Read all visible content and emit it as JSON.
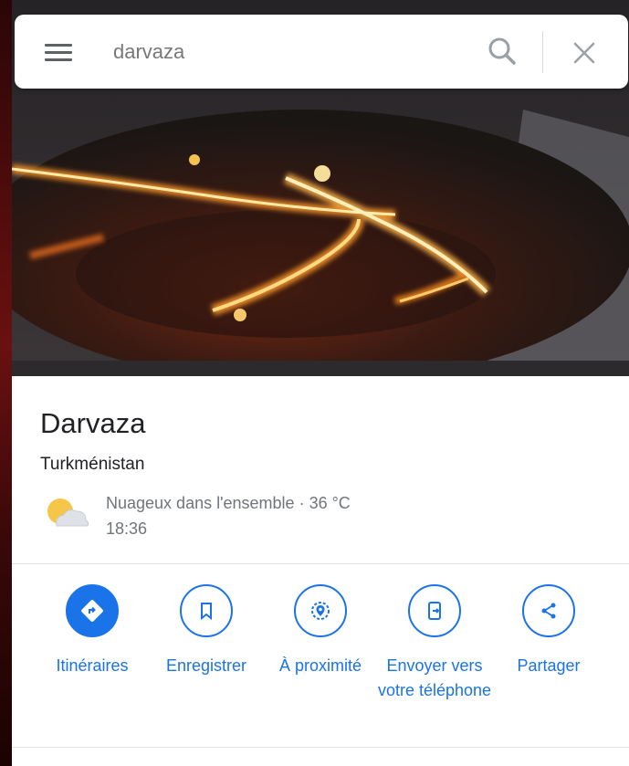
{
  "search": {
    "query": "darvaza"
  },
  "place": {
    "name": "Darvaza",
    "country": "Turkménistan",
    "weather": {
      "condition": "Nuageux dans l'ensemble · 36 °C",
      "time": "18:36",
      "icon": "partly-cloudy-icon"
    }
  },
  "actions": [
    {
      "label": "Itinéraires",
      "icon": "directions-icon"
    },
    {
      "label": "Enregistrer",
      "icon": "bookmark-icon"
    },
    {
      "label": "À proximité",
      "icon": "nearby-icon"
    },
    {
      "label": "Envoyer vers votre téléphone",
      "icon": "send-to-phone-icon"
    },
    {
      "label": "Partager",
      "icon": "share-icon"
    }
  ],
  "colors": {
    "accent": "#1a73e8",
    "text": "#202124",
    "muted": "#70757a"
  }
}
